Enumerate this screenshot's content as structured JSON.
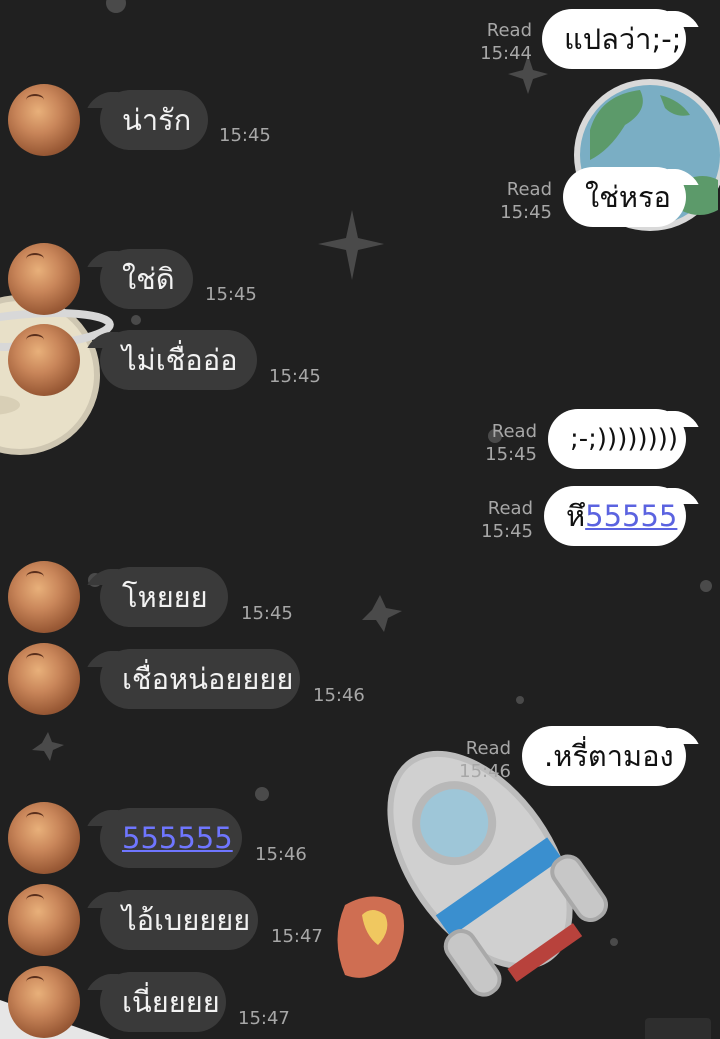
{
  "chat": {
    "read_label": "Read",
    "messages": [
      {
        "from": "me",
        "text": "แปลว่า;-;",
        "time": "15:44",
        "read": true
      },
      {
        "from": "them",
        "text": "น่ารัก",
        "time": "15:45"
      },
      {
        "from": "me",
        "text": "ใช่หรอ",
        "time": "15:45",
        "read": true
      },
      {
        "from": "them",
        "text": "ใช่ดิ",
        "time": "15:45"
      },
      {
        "from": "them",
        "text": "ไม่เชื่ออ่อ",
        "time": "15:45"
      },
      {
        "from": "me",
        "text": ";-;))))))))",
        "time": "15:45",
        "read": true
      },
      {
        "from": "me",
        "text_prefix": "หึ",
        "text_link": "55555",
        "time": "15:45",
        "read": true
      },
      {
        "from": "them",
        "text": "โหยยย",
        "time": "15:45"
      },
      {
        "from": "them",
        "text": "เชื่อหน่อยยยย",
        "time": "15:46"
      },
      {
        "from": "me",
        "text": ".หรี่ตามอง",
        "time": "15:46",
        "read": true
      },
      {
        "from": "them",
        "text_link": "555555",
        "time": "15:46"
      },
      {
        "from": "them",
        "text": "ไอ้เบยยยย",
        "time": "15:47"
      },
      {
        "from": "them",
        "text": "เนี่ยยยย",
        "time": "15:47"
      }
    ]
  },
  "theme": {
    "background": "#202020",
    "bubble_in": "#3a3a3a",
    "bubble_out": "#ffffff",
    "timestamp": "#a7a7a7",
    "link": "#5b63e0"
  },
  "decorations": [
    "planet-earth-icon",
    "planet-saturn-icon",
    "star-icon",
    "rocket-icon"
  ]
}
